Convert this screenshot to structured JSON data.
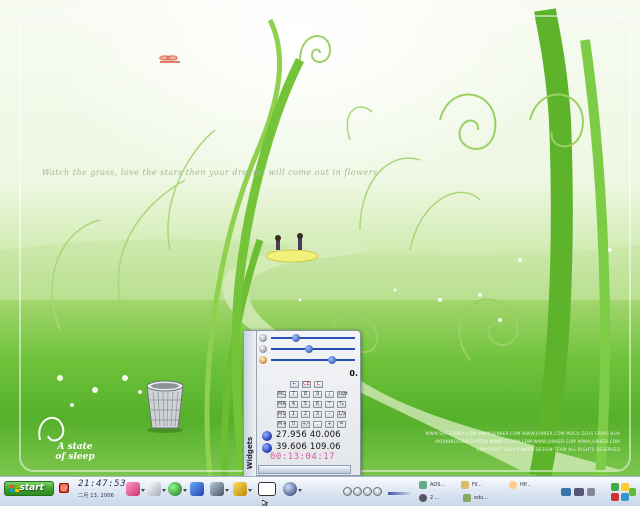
{
  "wallpaper": {
    "tagline": "Watch the grass, love the stars then your dreams will come out in flowers",
    "logo_line1": "A state",
    "logo_line2": "of sleep",
    "footer_line1": "WWW.SOFTCHINA.COM   WWW.JUNKER.COM   WWW.JUNKER.COM   MOCO ZEUS   CRAIG HUA",
    "footer_line2": "MORNINGSTAR  SYSTEM    WWW.CROOM.COM    WWW.JUNKER.COM    WWW.JUNKER.COM",
    "footer_line3": "COPYRIGHT 2006 JUNKER DESIGN TEAM  ALL RIGHTS RESERVED"
  },
  "widgets": {
    "tab_label": "Widgets",
    "sliders": [
      {
        "icon": "speaker-icon",
        "level": 0.28
      },
      {
        "icon": "brightness-icon",
        "level": 0.45
      },
      {
        "icon": "mic-icon",
        "level": 0.75
      }
    ],
    "calculator": {
      "display": "0.",
      "keys": [
        [
          "←",
          "CE",
          "C"
        ],
        [
          "MC",
          "7",
          "8",
          "9",
          "/",
          "sqrt"
        ],
        [
          "MR",
          "4",
          "5",
          "6",
          "*",
          "%"
        ],
        [
          "MS",
          "1",
          "2",
          "3",
          "-",
          "1/x"
        ],
        [
          "M+",
          "0",
          "+/-",
          ".",
          "+",
          "="
        ]
      ]
    },
    "weather": {
      "row1": "27.956  40.006",
      "row2": "39.606  109.06"
    },
    "clock": "00:13:04:17"
  },
  "taskbar": {
    "start_label": "start",
    "time": "21:47:53",
    "date": "二月 13, 2006",
    "quick_launch_icons": [
      "paint-icon",
      "notepad-icon",
      "network-icon",
      "messenger-icon",
      "screen-icon",
      "folder-icon",
      "calendar-icon",
      "gear-icon"
    ],
    "tasks": [
      {
        "label": "ADS...",
        "icon": "window-icon"
      },
      {
        "label": "Fil...",
        "icon": "folder-icon"
      },
      {
        "label": "HP...",
        "icon": "app-icon"
      },
      {
        "label": "2 ...",
        "icon": "pin-icon"
      },
      {
        "label": "edu...",
        "icon": "app-icon"
      }
    ]
  },
  "colors": {
    "start_green": "#3c9f2c",
    "slider_blue": "#2a50b5",
    "clock_pink": "#d55aa0"
  }
}
